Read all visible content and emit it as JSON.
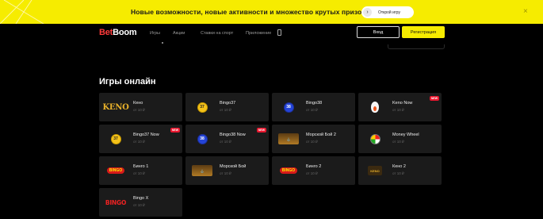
{
  "promo": {
    "text": "Новые возможности, новые активности и множество крутых призов",
    "button_label": "Открой игру",
    "close_symbol": "×",
    "arrow_symbol": "›"
  },
  "header": {
    "logo_bet": "Bet",
    "logo_boom": "Boom",
    "nav": [
      "Игры",
      "Акции",
      "Ставки на спорт",
      "Приложение"
    ],
    "login_label": "Вход",
    "register_label": "Регистрация"
  },
  "section": {
    "title": "Игры онлайн"
  },
  "games": [
    {
      "name": "Кено",
      "price": "от 10 ₽",
      "icon": "keno-logo",
      "icon_text": "KENO",
      "badge": ""
    },
    {
      "name": "Bingo37",
      "price": "от 10 ₽",
      "icon": "ball-37-yellow",
      "icon_text": "37",
      "badge": ""
    },
    {
      "name": "Bingo38",
      "price": "от 10 ₽",
      "icon": "ball-38-blue",
      "icon_text": "38",
      "badge": ""
    },
    {
      "name": "Keno Now",
      "price": "от 10 ₽",
      "icon": "flame-icon",
      "icon_text": "",
      "badge": "NEW"
    },
    {
      "name": "Bingo37 Now",
      "price": "от 10 ₽",
      "icon": "ball-37-yellow",
      "icon_text": "37",
      "badge": "NEW"
    },
    {
      "name": "Bingo38 Now",
      "price": "от 10 ₽",
      "icon": "ball-38-blue",
      "icon_text": "38",
      "badge": "NEW"
    },
    {
      "name": "Морской Бой 2",
      "price": "от 10 ₽",
      "icon": "sea-battle-logo",
      "icon_text": "",
      "badge": ""
    },
    {
      "name": "Money Wheel",
      "price": "от 10 ₽",
      "icon": "wheel-icon",
      "icon_text": "",
      "badge": ""
    },
    {
      "name": "Бинго 1",
      "price": "от 10 ₽",
      "icon": "bingo-pill-logo",
      "icon_text": "BINGO",
      "badge": ""
    },
    {
      "name": "Морской Бой",
      "price": "от 10 ₽",
      "icon": "sea-battle-logo",
      "icon_text": "",
      "badge": ""
    },
    {
      "name": "Бинго 2",
      "price": "от 10 ₽",
      "icon": "bingo-pill-logo",
      "icon_text": "BINGO",
      "badge": ""
    },
    {
      "name": "Кено 2",
      "price": "от 10 ₽",
      "icon": "keno2-logo",
      "icon_text": "KENO",
      "badge": ""
    },
    {
      "name": "Bingo X",
      "price": "от 10 ₽",
      "icon": "bingox-logo",
      "icon_text": "BINGO",
      "badge": ""
    }
  ],
  "colors": {
    "accent_yellow": "#f6ec00",
    "brand_red": "#ff3b3b",
    "badge_red": "#e9172f",
    "card_bg": "#1b1b1b"
  }
}
